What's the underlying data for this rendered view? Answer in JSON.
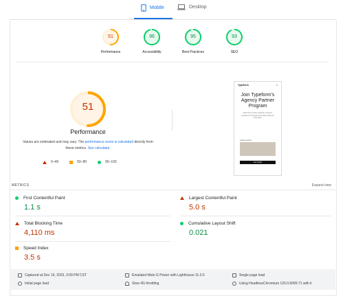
{
  "tabs": {
    "mobile": "Mobile",
    "desktop": "Desktop"
  },
  "scores": [
    {
      "value": "51",
      "label": "Performance",
      "color": "#ffa400",
      "fraction": 0.51
    },
    {
      "value": "96",
      "label": "Accessibility",
      "color": "#0cce6b",
      "fraction": 0.96
    },
    {
      "value": "95",
      "label": "Best Practices",
      "color": "#0cce6b",
      "fraction": 0.95
    },
    {
      "value": "93",
      "label": "SEO",
      "color": "#0cce6b",
      "fraction": 0.93
    }
  ],
  "main": {
    "score": "51",
    "title": "Performance",
    "desc_a": "Values are estimated and may vary. The ",
    "desc_link1": "performance score is calculated",
    "desc_b": " directly from these metrics. ",
    "desc_link2": "See calculator.",
    "legend": {
      "bad": "0–49",
      "avg": "50–89",
      "good": "90–100"
    }
  },
  "preview": {
    "brand": "Typeform",
    "close": "×",
    "headline": "Join Typeform's Agency Partner Program",
    "body": "Help clients create seamless customer experiences that give them better data and more sales.",
    "form_label": "Create account",
    "button": "Get started"
  },
  "metrics": {
    "label": "METRICS",
    "expand": "Expand view",
    "fcp": {
      "name": "First Contentful Paint",
      "value": "1.1 s"
    },
    "lcp": {
      "name": "Largest Contentful Paint",
      "value": "5.0 s"
    },
    "tbt": {
      "name": "Total Blocking Time",
      "value": "4,110 ms"
    },
    "cls": {
      "name": "Cumulative Layout Shift",
      "value": "0.021"
    },
    "si": {
      "name": "Speed Index",
      "value": "3.5 s"
    }
  },
  "footer": {
    "captured": "Captured at Dec 19, 2023, 3:09 PM CST",
    "initial": "Initial page load",
    "device": "Emulated Moto G Power with Lighthouse 11.0.0",
    "throttle": "Slow 4G throttling",
    "session": "Single page load",
    "browser": "Using HeadlessChromium 120.0.6099.71 with lr"
  },
  "colors": {
    "accent": "#1a73e8",
    "fail": "#c33300",
    "average": "#ffa400",
    "pass": "#0cce6b"
  }
}
